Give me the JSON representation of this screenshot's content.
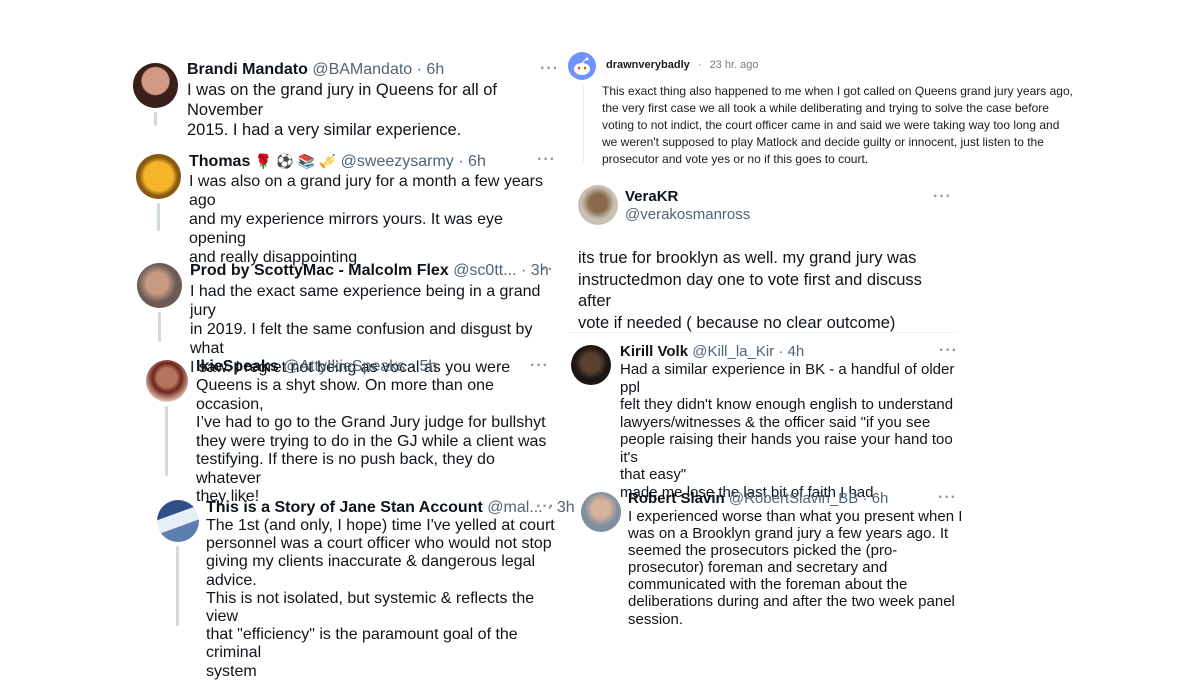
{
  "tweets_left": [
    {
      "name": "Brandi Mandato",
      "handle": "@BAMandato",
      "time": "· 6h",
      "text": "I was on the grand jury in Queens for all of November\n2015. I had a very similar experience."
    },
    {
      "name": "Thomas",
      "name_emoji": "🌹 ⚽ 📚 🎺",
      "handle": "@sweezysarmy",
      "time": "· 6h",
      "text": "I was also on a grand jury for a month a few years ago\nand my experience mirrors yours. It was eye opening\nand really disappointing"
    },
    {
      "name": "Prod by ScottyMac - Malcolm Flex",
      "handle": "@sc0tt...",
      "time": "· 3h",
      "text": "I had the exact same experience being in a grand jury\nin 2019. I felt the same confusion and disgust by what\nI saw. I regret not being as vocal as you were"
    },
    {
      "name": "IkieSpeaks",
      "handle": "@AttyIkieSpeaks",
      "time": "· 5h",
      "text": "Queens is a shyt show.  On more than one occasion,\nI’ve had to go to the Grand Jury judge for bullshyt\nthey were trying to do in the GJ while a client was\ntestifying. If there is no push back, they do whatever\nthey like!"
    },
    {
      "name": "This is a Story of Jane Stan Account",
      "handle": "@mal...",
      "time": "· 3h",
      "text": "The 1st (and only, I hope) time I've yelled at court\npersonnel was a court officer who would not stop\ngiving my clients inaccurate & dangerous legal advice.\nThis is not isolated, but systemic & reflects the view\nthat \"efficiency\" is the paramount goal of the criminal\nsystem"
    }
  ],
  "reddit_comment": {
    "username": "drawnverybadly",
    "separator": "·",
    "time": "23 hr. ago",
    "text": "This exact thing also happened to me when I got called on Queens grand jury years ago, the very first case we all took a while deliberating and trying to solve the case before voting to not indict, the court officer came in and said we were taking way too long and we weren't supposed to play Matlock and decide guilty or innocent, just listen to the prosecutor and vote yes or no if this goes to court."
  },
  "tweet_verakr": {
    "name": "VeraKR",
    "handle": "@verakosmanross",
    "text": "its true for brooklyn as well.  my grand jury was\ninstructedmon day one to vote first and discuss after\nvote if needed ( because no clear outcome)"
  },
  "tweets_right": [
    {
      "name": "Kirill Volk",
      "handle": "@Kill_la_Kir",
      "time": "· 4h",
      "text": "Had a similar experience in BK - a handful of older ppl\nfelt they didn't know enough english to understand\nlawyers/witnesses & the officer said \"if you see\npeople raising their hands you raise your hand too it's\nthat easy\"\nmade me lose the last bit of faith I had"
    },
    {
      "name": "Robert Slavin",
      "handle": "@RobertSlavin_BB",
      "time": "· 6h",
      "text": "I experienced worse than what you present when I\nwas on a Brooklyn grand jury a few years ago. It\nseemed the prosecutors picked the (pro-\nprosecutor) foreman and secretary and\ncommunicated with the foreman about the\ndeliberations during and after the two week panel\nsession."
    }
  ],
  "more_label": "···",
  "colors": {
    "text": "#0f1419",
    "meta": "#536471",
    "thread_line": "#cfd9de",
    "reddit_avatar": "#7193ff"
  },
  "icons": [
    "more-options-icon",
    "reddit-snoo-avatar-icon"
  ]
}
